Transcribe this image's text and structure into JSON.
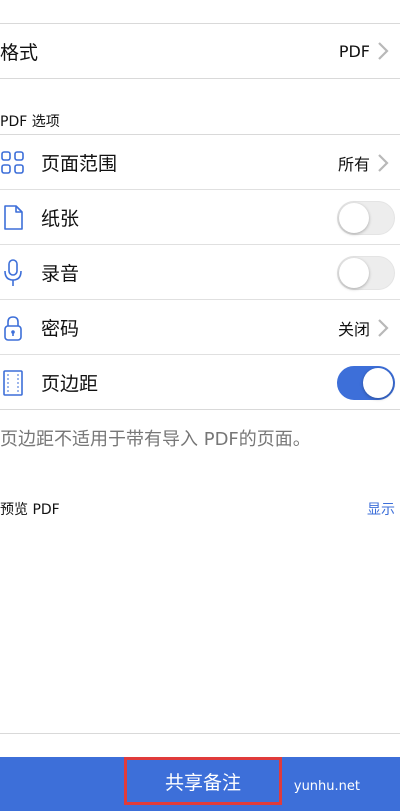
{
  "format": {
    "label": "格式",
    "value": "PDF"
  },
  "pdf_options": {
    "title": "PDF 选项",
    "rows": [
      {
        "label": "页面范围",
        "value": "所有",
        "icon": "grid-icon"
      },
      {
        "label": "纸张",
        "toggle": false,
        "icon": "page-icon"
      },
      {
        "label": "录音",
        "toggle": false,
        "icon": "microphone-icon"
      },
      {
        "label": "密码",
        "value": "关闭",
        "icon": "lock-icon"
      },
      {
        "label": "页边距",
        "toggle": true,
        "icon": "margins-icon"
      }
    ],
    "note": "页边距不适用于带有导入 PDF的页面。"
  },
  "preview": {
    "label": "预览 PDF",
    "action": "显示"
  },
  "bottom": {
    "share_label": "共享备注",
    "watermark": "yunhu.net"
  },
  "colors": {
    "accent": "#3d6fd9",
    "highlight_border": "#e03b3b"
  }
}
